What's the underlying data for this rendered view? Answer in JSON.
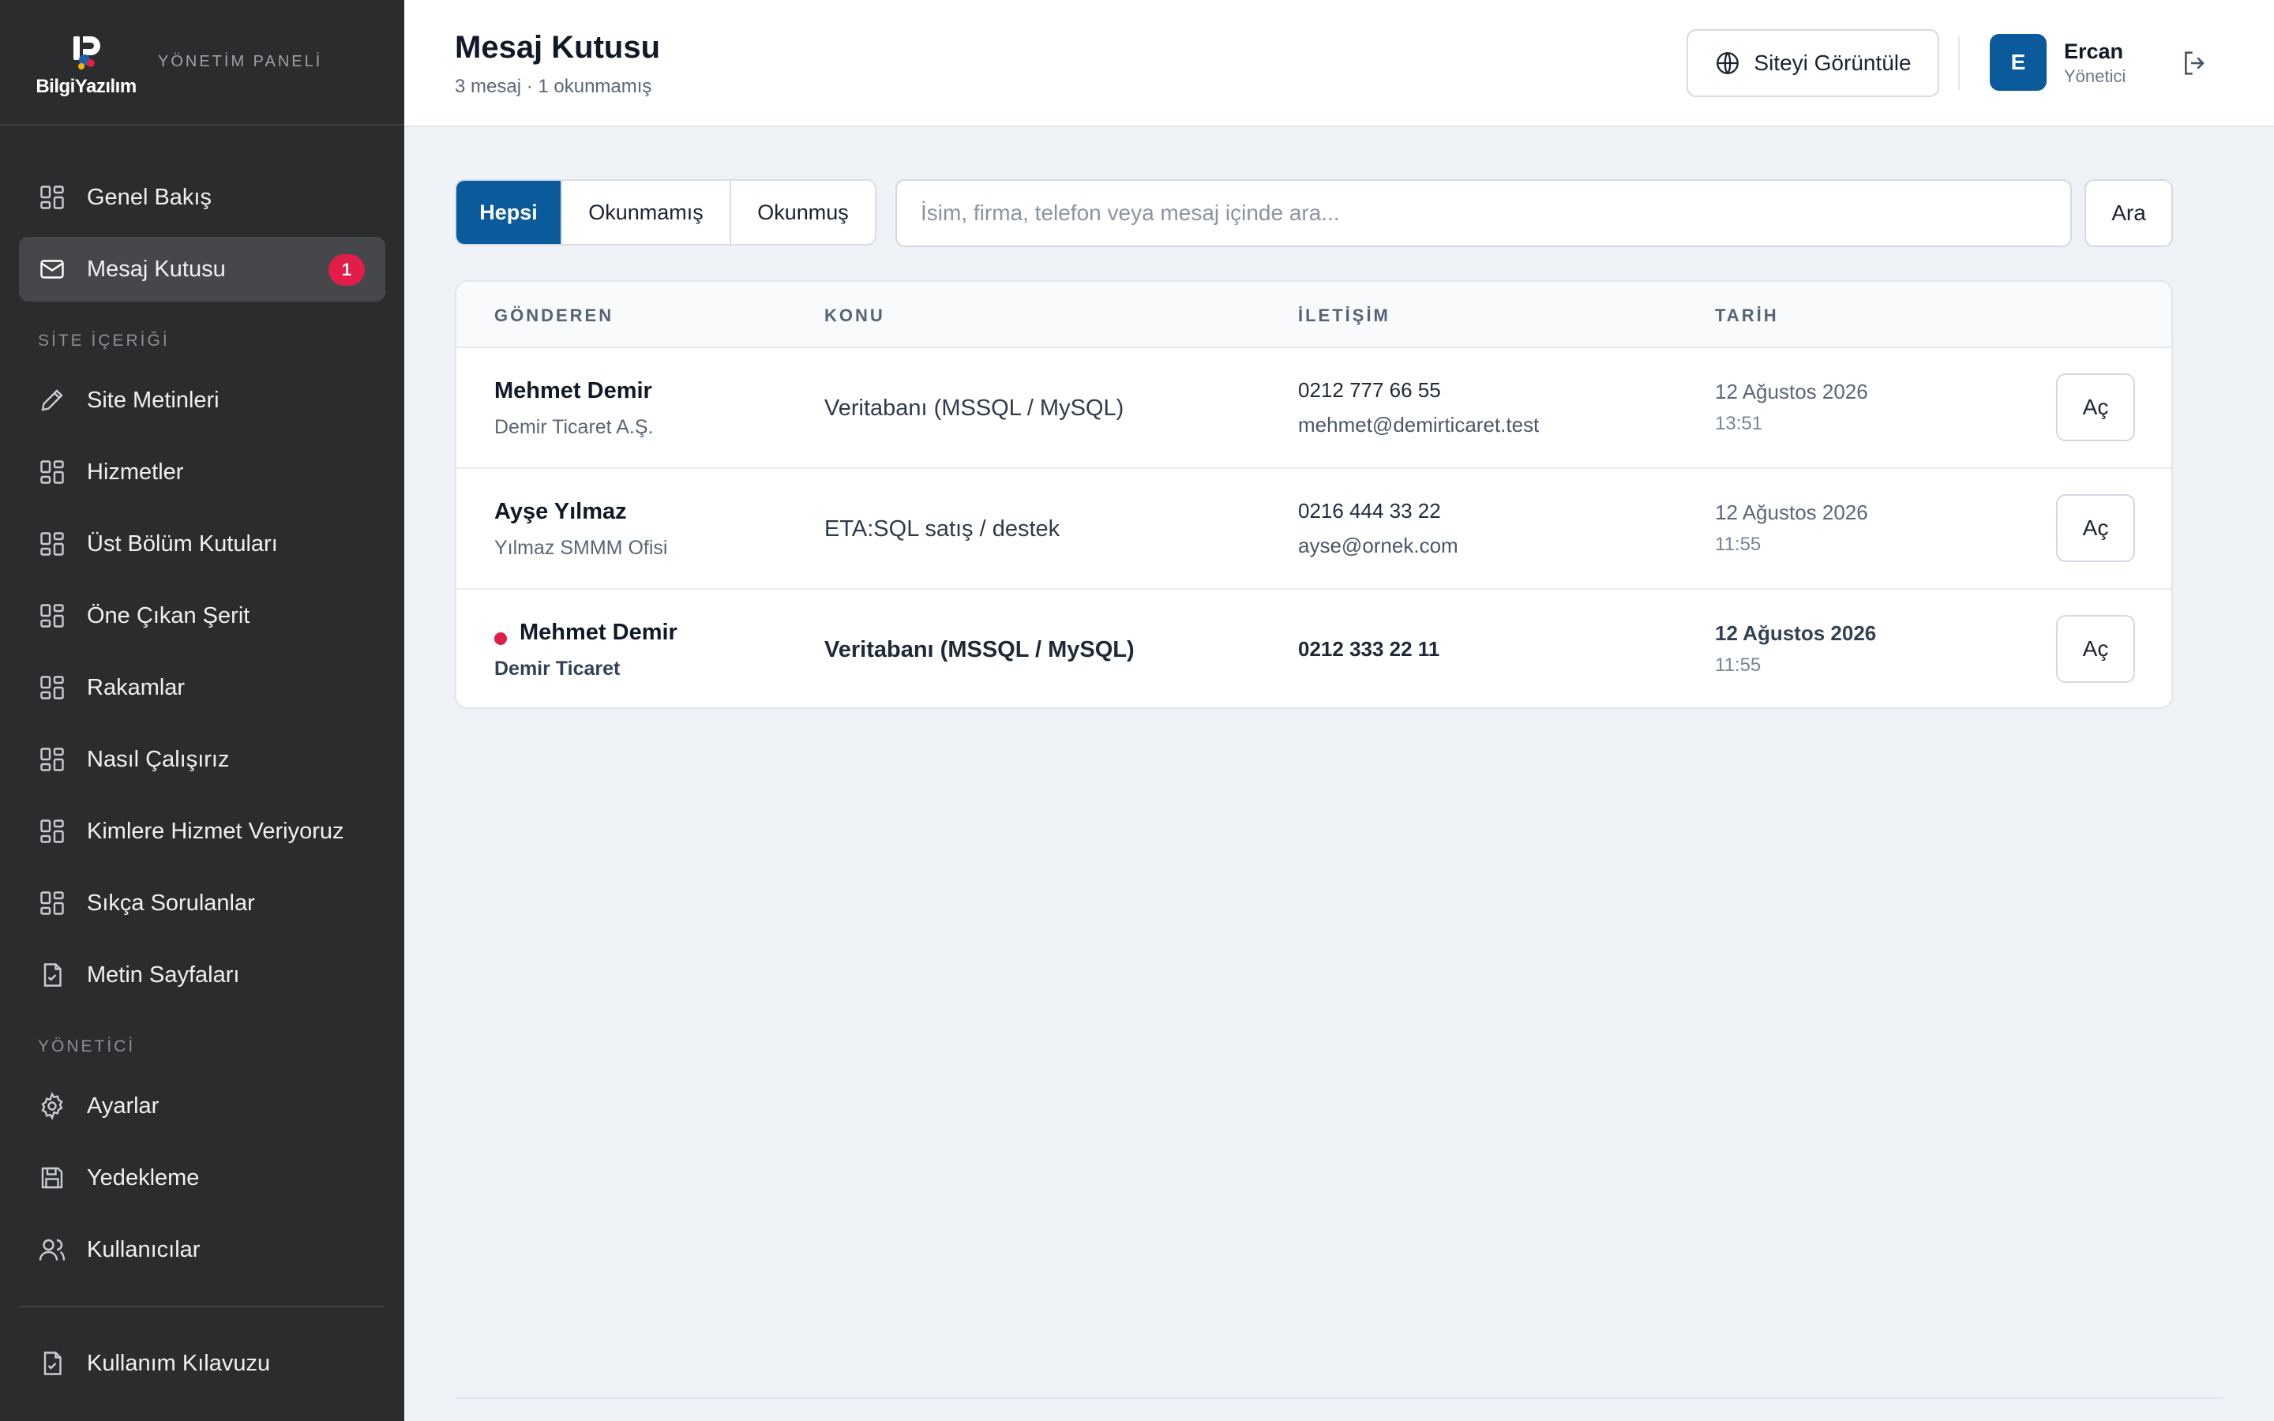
{
  "brand": {
    "logo_text": "BilgiYazılım",
    "subtitle": "YÖNETİM PANELİ"
  },
  "sidebar": {
    "primary": [
      {
        "label": "Genel Bakış",
        "icon": "grid-icon"
      },
      {
        "label": "Mesaj Kutusu",
        "icon": "mail-icon",
        "badge": "1",
        "active": true
      }
    ],
    "section_content": "SİTE İÇERİĞİ",
    "content_items": [
      {
        "label": "Site Metinleri",
        "icon": "pencil-icon"
      },
      {
        "label": "Hizmetler",
        "icon": "grid-icon"
      },
      {
        "label": "Üst Bölüm Kutuları",
        "icon": "grid-icon"
      },
      {
        "label": "Öne Çıkan Şerit",
        "icon": "grid-icon"
      },
      {
        "label": "Rakamlar",
        "icon": "grid-icon"
      },
      {
        "label": "Nasıl Çalışırız",
        "icon": "grid-icon"
      },
      {
        "label": "Kimlere Hizmet Veriyoruz",
        "icon": "grid-icon"
      },
      {
        "label": "Sıkça Sorulanlar",
        "icon": "grid-icon"
      },
      {
        "label": "Metin Sayfaları",
        "icon": "document-icon"
      }
    ],
    "section_admin": "YÖNETİCİ",
    "admin_items": [
      {
        "label": "Ayarlar",
        "icon": "gear-icon"
      },
      {
        "label": "Yedekleme",
        "icon": "save-icon"
      },
      {
        "label": "Kullanıcılar",
        "icon": "users-icon"
      }
    ],
    "guide_label": "Kullanım Kılavuzu"
  },
  "header": {
    "title": "Mesaj Kutusu",
    "subtitle": "3 mesaj · 1 okunmamış",
    "view_site_label": "Siteyi Görüntüle",
    "user_initial": "E",
    "user_name": "Ercan",
    "user_role": "Yönetici"
  },
  "filters": {
    "tabs": [
      "Hepsi",
      "Okunmamış",
      "Okunmuş"
    ],
    "active_index": 0
  },
  "search": {
    "value": "",
    "placeholder": "İsim, firma, telefon veya mesaj içinde ara...",
    "button_label": "Ara"
  },
  "table": {
    "columns": [
      "GÖNDEREN",
      "KONU",
      "İLETİŞİM",
      "TARİH"
    ],
    "open_label": "Aç",
    "rows": [
      {
        "sender": "Mehmet Demir",
        "company": "Demir Ticaret A.Ş.",
        "subject": "Veritabanı (MSSQL / MySQL)",
        "phone": "0212 777 66 55",
        "email": "mehmet@demirticaret.test",
        "date": "12 Ağustos 2026",
        "time": "13:51",
        "unread": false
      },
      {
        "sender": "Ayşe Yılmaz",
        "company": "Yılmaz SMMM Ofisi",
        "subject": "ETA:SQL satış / destek",
        "phone": "0216 444 33 22",
        "email": "ayse@ornek.com",
        "date": "12 Ağustos 2026",
        "time": "11:55",
        "unread": false
      },
      {
        "sender": "Mehmet Demir",
        "company": "Demir Ticaret",
        "subject": "Veritabanı (MSSQL / MySQL)",
        "phone": "0212 333 22 11",
        "email": "",
        "date": "12 Ağustos 2026",
        "time": "11:55",
        "unread": true
      }
    ]
  },
  "colors": {
    "sidebar_bg": "#2b2c2e",
    "accent": "#0a5a9c",
    "badge": "#e11d48",
    "page_bg": "#eff2f7"
  }
}
